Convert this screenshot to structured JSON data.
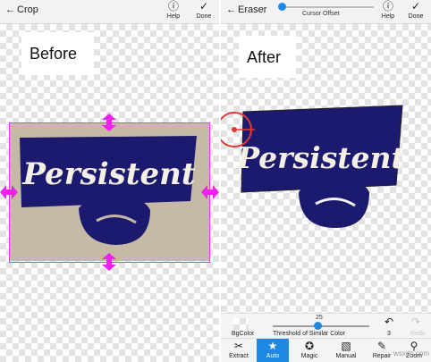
{
  "left_panel": {
    "title": "Crop",
    "help_label": "Help",
    "done_label": "Done",
    "before_label": "Before"
  },
  "right_panel": {
    "title": "Eraser",
    "slider_label": "Cursor Offset",
    "help_label": "Help",
    "done_label": "Done",
    "after_label": "After",
    "bgcolor_label": "BgColor",
    "threshold_value": "25",
    "threshold_label": "Threshold of Similar Color",
    "undo_count": "3",
    "redo_label": "Redo",
    "tools": [
      {
        "label": "Extract",
        "icon": "scissors-icon"
      },
      {
        "label": "Auto",
        "icon": "star-icon"
      },
      {
        "label": "Magic",
        "icon": "magic-icon"
      },
      {
        "label": "Manual",
        "icon": "eraser-icon"
      },
      {
        "label": "Repair",
        "icon": "brush-icon"
      },
      {
        "label": "Zoom",
        "icon": "search-icon"
      }
    ]
  },
  "artwork_text": "Persistent",
  "watermark": "wsxdn.com",
  "colors": {
    "accent_blue": "#1e88e5",
    "crop_border": "#e040e0",
    "handle_magenta": "#ee22ee",
    "sign_navy": "#1c1a6e",
    "cursor_red": "#e53935"
  }
}
